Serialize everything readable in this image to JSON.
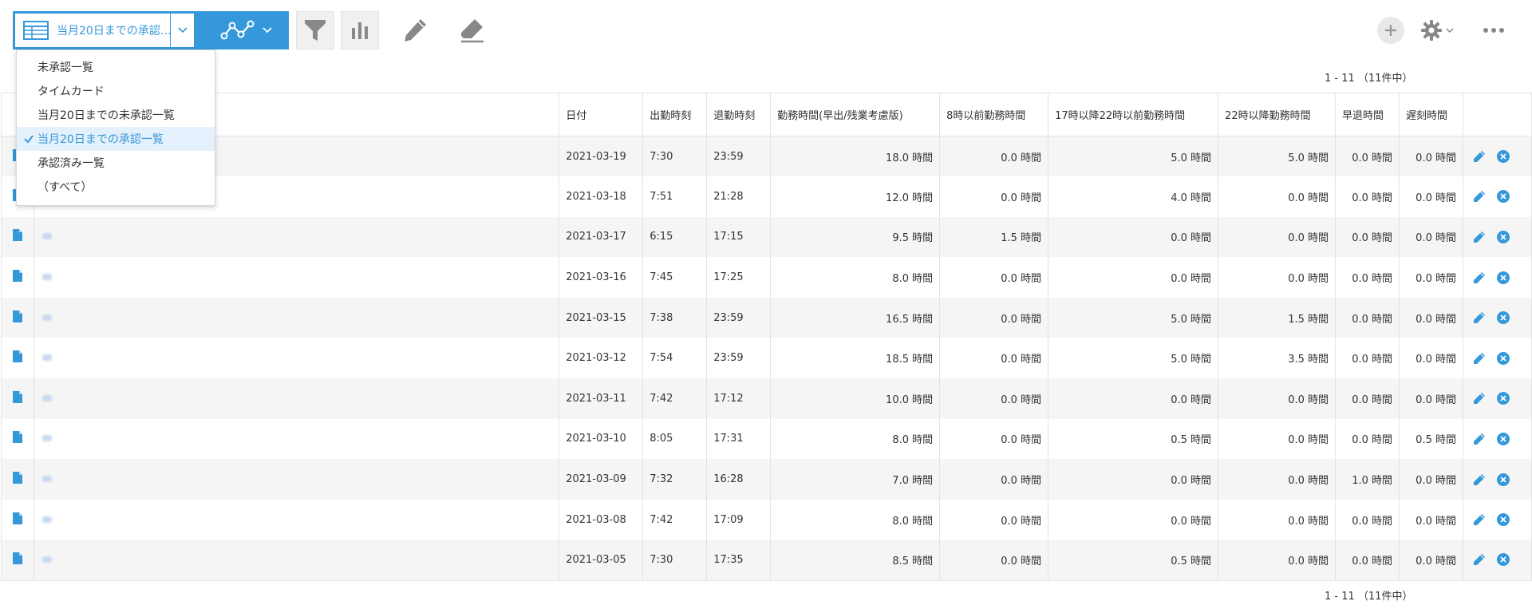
{
  "toolbar": {
    "view_select_label": "当月20日までの承認…"
  },
  "dropdown": {
    "items": [
      {
        "label": "未承認一覧",
        "selected": false
      },
      {
        "label": "タイムカード",
        "selected": false
      },
      {
        "label": "当月20日までの未承認一覧",
        "selected": false
      },
      {
        "label": "当月20日までの承認一覧",
        "selected": true
      },
      {
        "label": "承認済み一覧",
        "selected": false
      },
      {
        "label": "（すべて）",
        "selected": false
      }
    ]
  },
  "pager": {
    "top": "1 - 11 （11件中）",
    "bottom": "1 - 11 （11件中）"
  },
  "table": {
    "headers": [
      "日付",
      "出勤時刻",
      "退勤時刻",
      "勤務時間(早出/残業考慮版)",
      "8時以前勤務時間",
      "17時以降22時以前勤務時間",
      "22時以降勤務時間",
      "早退時間",
      "遅刻時間"
    ],
    "rows": [
      [
        "2021-03-19",
        "7:30",
        "23:59",
        "18.0 時間",
        "0.0 時間",
        "5.0 時間",
        "5.0 時間",
        "0.0 時間",
        "0.0 時間"
      ],
      [
        "2021-03-18",
        "7:51",
        "21:28",
        "12.0 時間",
        "0.0 時間",
        "4.0 時間",
        "0.0 時間",
        "0.0 時間",
        "0.0 時間"
      ],
      [
        "2021-03-17",
        "6:15",
        "17:15",
        "9.5 時間",
        "1.5 時間",
        "0.0 時間",
        "0.0 時間",
        "0.0 時間",
        "0.0 時間"
      ],
      [
        "2021-03-16",
        "7:45",
        "17:25",
        "8.0 時間",
        "0.0 時間",
        "0.0 時間",
        "0.0 時間",
        "0.0 時間",
        "0.0 時間"
      ],
      [
        "2021-03-15",
        "7:38",
        "23:59",
        "16.5 時間",
        "0.0 時間",
        "5.0 時間",
        "1.5 時間",
        "0.0 時間",
        "0.0 時間"
      ],
      [
        "2021-03-12",
        "7:54",
        "23:59",
        "18.5 時間",
        "0.0 時間",
        "5.0 時間",
        "3.5 時間",
        "0.0 時間",
        "0.0 時間"
      ],
      [
        "2021-03-11",
        "7:42",
        "17:12",
        "10.0 時間",
        "0.0 時間",
        "0.0 時間",
        "0.0 時間",
        "0.0 時間",
        "0.0 時間"
      ],
      [
        "2021-03-10",
        "8:05",
        "17:31",
        "8.0 時間",
        "0.0 時間",
        "0.5 時間",
        "0.0 時間",
        "0.0 時間",
        "0.5 時間"
      ],
      [
        "2021-03-09",
        "7:32",
        "16:28",
        "7.0 時間",
        "0.0 時間",
        "0.0 時間",
        "0.0 時間",
        "1.0 時間",
        "0.0 時間"
      ],
      [
        "2021-03-08",
        "7:42",
        "17:09",
        "8.0 時間",
        "0.0 時間",
        "0.0 時間",
        "0.0 時間",
        "0.0 時間",
        "0.0 時間"
      ],
      [
        "2021-03-05",
        "7:30",
        "17:35",
        "8.5 時間",
        "0.0 時間",
        "0.5 時間",
        "0.0 時間",
        "0.0 時間",
        "0.0 時間"
      ]
    ]
  },
  "icons": {
    "record": "record-detail-icon",
    "edit": "pencil-icon",
    "delete": "close-circle-icon"
  },
  "colors": {
    "accent": "#3498db",
    "row_alt": "#f5f5f5",
    "border": "#e3e3e3",
    "icon_gray": "#888888"
  }
}
